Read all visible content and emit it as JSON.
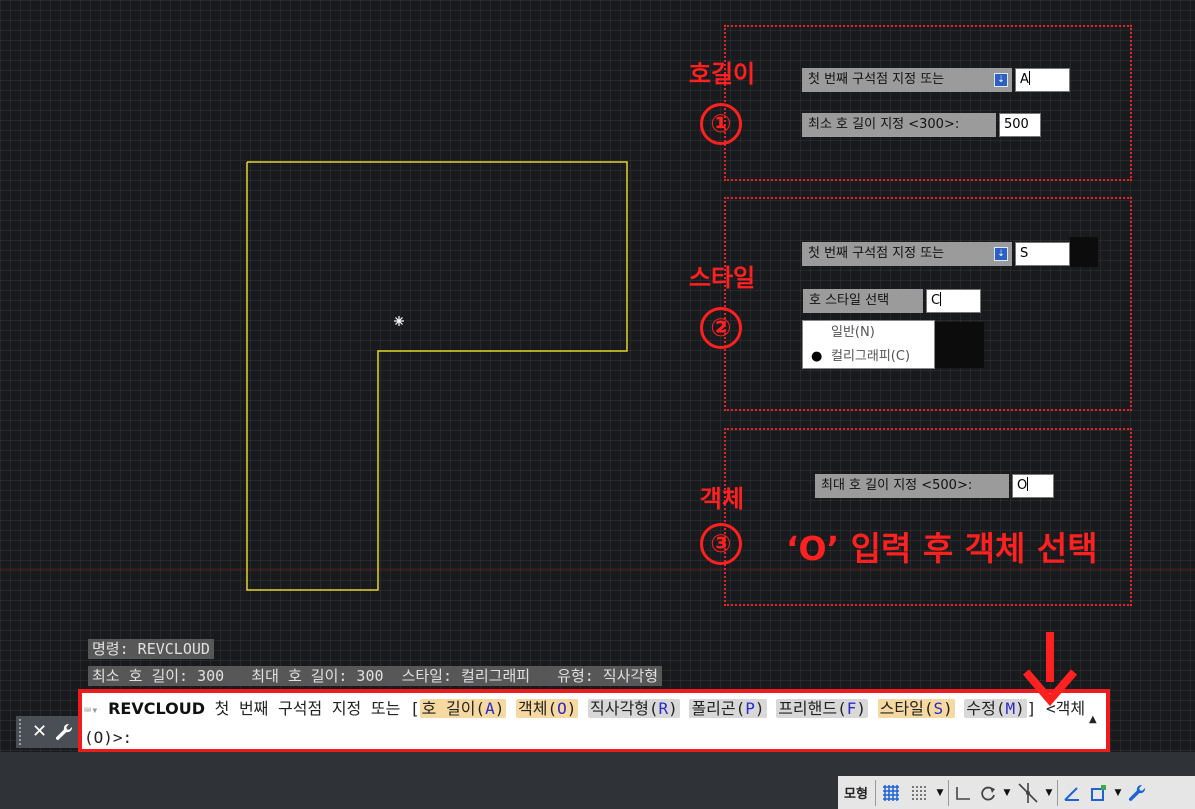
{
  "panels": [
    {
      "title": "호길이",
      "number": "①",
      "prompts": [
        {
          "label": "첫 번째 구석점 지정 또는",
          "value": "A",
          "has_button": true
        },
        {
          "label": "최소 호 길이 지정 <300>:",
          "value": "500",
          "has_button": false
        }
      ]
    },
    {
      "title": "스타일",
      "number": "②",
      "prompts": [
        {
          "label": "첫 번째 구석점 지정 또는",
          "value": "S",
          "has_button": true
        },
        {
          "label": "호 스타일 선택",
          "value": "C",
          "has_button": false
        }
      ],
      "dropdown_options": [
        "일반(N)",
        "컬리그래피(C)"
      ],
      "dropdown_selected": "컬리그래피(C)"
    },
    {
      "title": "객체",
      "number": "③",
      "prompts": [
        {
          "label": "최대 호 길이 지정 <500>:",
          "value": "O",
          "has_button": false
        }
      ],
      "note": "‘O’ 입력 후 객체 선택"
    }
  ],
  "history": {
    "line1": "명령: REVCLOUD",
    "line2": "최소 호 길이: 300   최대 호 길이: 300  스타일: 컬리그래피   유형: 직사각형"
  },
  "command_line": {
    "command": "REVCLOUD",
    "prompt_text": "첫 번째 구석점 지정 또는",
    "open_bracket": "[",
    "options": [
      {
        "label": "호 길이",
        "key": "A",
        "style": "hl"
      },
      {
        "label": "객체",
        "key": "O",
        "style": "hl"
      },
      {
        "label": "직사각형",
        "key": "R",
        "style": "gr"
      },
      {
        "label": "폴리곤",
        "key": "P",
        "style": "gr"
      },
      {
        "label": "프리핸드",
        "key": "F",
        "style": "gr"
      },
      {
        "label": "스타일",
        "key": "S",
        "style": "hl"
      },
      {
        "label": "수정",
        "key": "M",
        "style": "gr"
      }
    ],
    "close_bracket": "]",
    "default_text": "<객체(O)>:"
  },
  "statusbar": {
    "model_label": "모형"
  },
  "colors": {
    "annotation_red": "#ff2020",
    "drawing_line": "#e3d627",
    "highlight_option": "#f5d9a0",
    "key_letter": "#2a2ac8"
  },
  "icons": [
    "close-icon",
    "wrench-icon",
    "grid-icon",
    "snap-icon",
    "ortho-icon",
    "polar-icon",
    "osnap-icon",
    "annotation-icon",
    "workspace-icon"
  ]
}
